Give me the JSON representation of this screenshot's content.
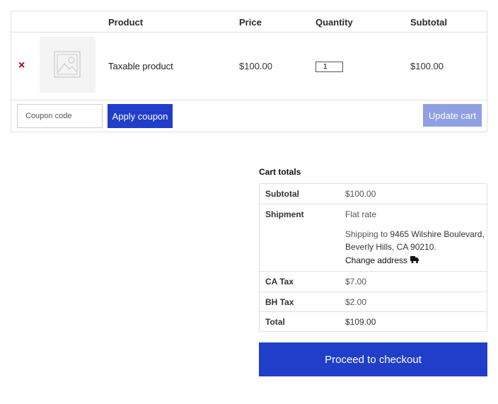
{
  "cart": {
    "headers": {
      "product": "Product",
      "price": "Price",
      "quantity": "Quantity",
      "subtotal": "Subtotal"
    },
    "items": [
      {
        "remove_symbol": "×",
        "thumbnail_icon": "image-placeholder-icon",
        "name": "Taxable product",
        "price": "$100.00",
        "quantity": "1",
        "subtotal": "$100.00"
      }
    ],
    "coupon_placeholder": "Coupon code",
    "apply_label": "Apply coupon",
    "update_label": "Update cart"
  },
  "totals": {
    "title": "Cart totals",
    "subtotal_label": "Subtotal",
    "subtotal_value": "$100.00",
    "shipment_label": "Shipment",
    "shipment_method": "Flat rate",
    "shipping_prefix": "Shipping to ",
    "shipping_address": "9465 Wilshire Boulevard, Beverly Hills, CA 90210.",
    "change_address_label": "Change address",
    "change_address_icon": "truck-icon",
    "ca_tax_label": "CA Tax",
    "ca_tax_value": "$7.00",
    "bh_tax_label": "BH Tax",
    "bh_tax_value": "$2.00",
    "total_label": "Total",
    "total_value": "$109.00"
  },
  "checkout_label": "Proceed to checkout",
  "colors": {
    "primary": "#213ec9",
    "disabled": "#8fa0e4",
    "remove": "#a00000",
    "border": "#e0e0e0"
  }
}
